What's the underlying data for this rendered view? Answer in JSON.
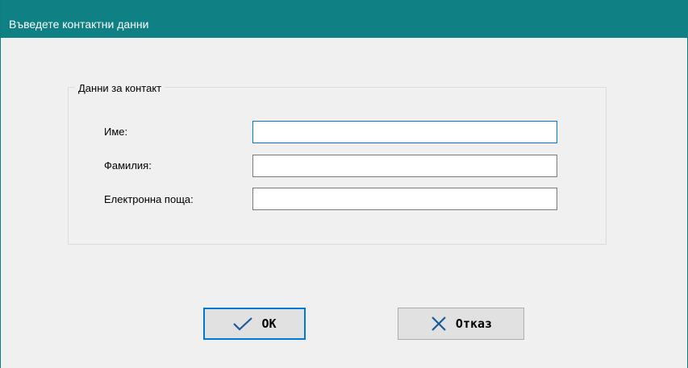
{
  "window": {
    "title": "Въведете контактни данни"
  },
  "group": {
    "legend": "Данни за контакт",
    "fields": [
      {
        "label": "Име:",
        "value": "",
        "placeholder": ""
      },
      {
        "label": "Фамилия:",
        "value": "",
        "placeholder": ""
      },
      {
        "label": "Електронна поща:",
        "value": "",
        "placeholder": ""
      }
    ]
  },
  "buttons": {
    "ok_label": "OK",
    "cancel_label": "Отказ",
    "ok_icon": "checkmark-icon",
    "cancel_icon": "close-icon"
  },
  "colors": {
    "titlebar": "#0f8083",
    "accent": "#0078d7"
  }
}
